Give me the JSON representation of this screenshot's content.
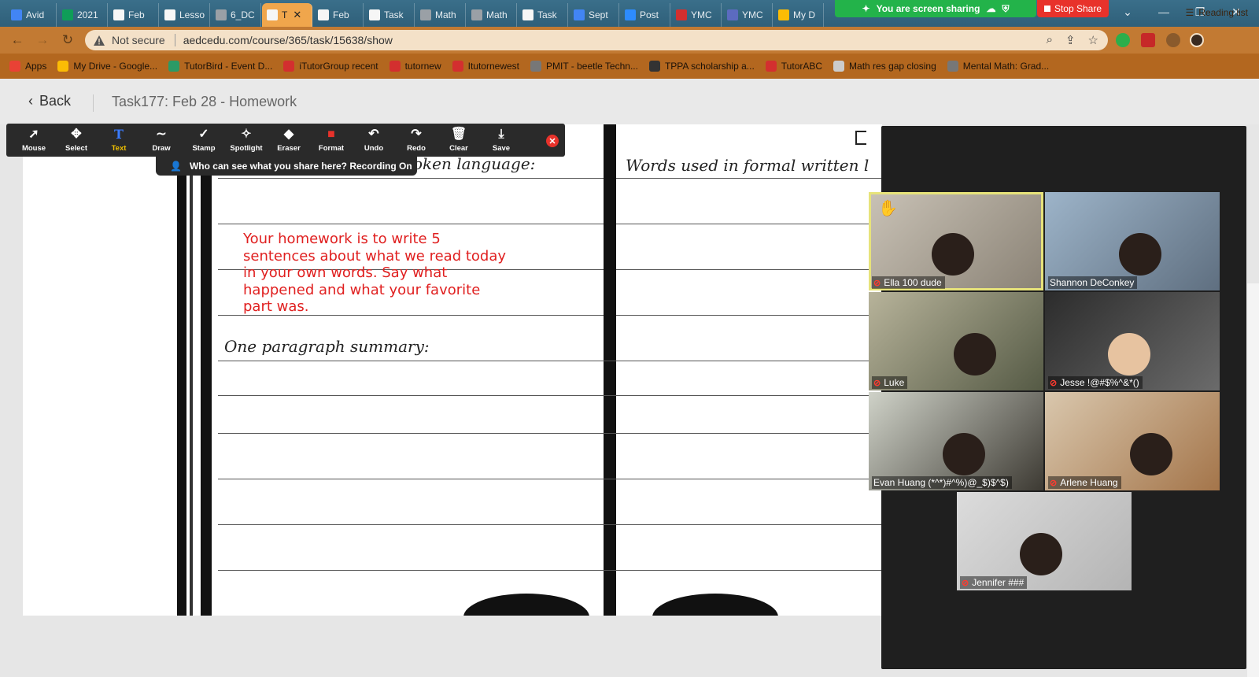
{
  "browser": {
    "tabs": [
      {
        "label": "Avid",
        "color": "#4285f4"
      },
      {
        "label": "2021",
        "color": "#0f9d58"
      },
      {
        "label": "Feb",
        "color": "#f6f6f6"
      },
      {
        "label": "Lesso",
        "color": "#f6f6f6"
      },
      {
        "label": "6_DC",
        "color": "#9aa0a6"
      },
      {
        "label": "T",
        "color": "#f6f6f6",
        "active": true
      },
      {
        "label": "Feb",
        "color": "#f6f6f6"
      },
      {
        "label": "Task",
        "color": "#f6f6f6"
      },
      {
        "label": "Math",
        "color": "#9aa0a6"
      },
      {
        "label": "Math",
        "color": "#9aa0a6"
      },
      {
        "label": "Task",
        "color": "#f6f6f6"
      },
      {
        "label": "Sept",
        "color": "#4285f4"
      },
      {
        "label": "Post",
        "color": "#2d8cff"
      },
      {
        "label": "YMC",
        "color": "#d32f2f"
      },
      {
        "label": "YMC",
        "color": "#5c6bc0"
      },
      {
        "label": "My D",
        "color": "#fbbc05"
      }
    ],
    "sharing_banner": "You are screen sharing",
    "stop_share": "Stop Share",
    "not_secure": "Not secure",
    "url": "aedcedu.com/course/365/task/15638/show",
    "bookmarks": [
      {
        "label": "Apps",
        "color": "#e94235"
      },
      {
        "label": "My Drive - Google...",
        "color": "#fbbc05"
      },
      {
        "label": "TutorBird - Event D...",
        "color": "#2b9a66"
      },
      {
        "label": "iTutorGroup recent",
        "color": "#d32f2f"
      },
      {
        "label": "tutornew",
        "color": "#d32f2f"
      },
      {
        "label": "Itutornewest",
        "color": "#d32f2f"
      },
      {
        "label": "PMIT - beetle Techn...",
        "color": "#777777"
      },
      {
        "label": "TPPA scholarship a...",
        "color": "#333333"
      },
      {
        "label": "TutorABC",
        "color": "#d32f2f"
      },
      {
        "label": "Math res gap closing",
        "color": "#cccccc"
      },
      {
        "label": "Mental Math: Grad...",
        "color": "#777777"
      }
    ],
    "reading_list": "Reading list"
  },
  "page": {
    "back_label": "Back",
    "title": "Task177:  Feb 28 - Homework"
  },
  "worksheet": {
    "left_heading_fragment": "oken language:",
    "right_heading_fragment": "Words used in formal written l",
    "summary_heading": "One paragraph summary:",
    "homework_text": "Your homework is to write 5 sentences about what we read today in your own words.  Say what happened and what your favorite part was."
  },
  "annotate": {
    "tools": [
      {
        "label": "Mouse",
        "icon": "cursor-arrow-icon",
        "glyph": "➚"
      },
      {
        "label": "Select",
        "icon": "move-arrows-icon",
        "glyph": "✥"
      },
      {
        "label": "Text",
        "icon": "text-t-icon",
        "glyph": "T",
        "selected": true
      },
      {
        "label": "Draw",
        "icon": "squiggle-icon",
        "glyph": "∼"
      },
      {
        "label": "Stamp",
        "icon": "checkmark-icon",
        "glyph": "✓"
      },
      {
        "label": "Spotlight",
        "icon": "magic-wand-icon",
        "glyph": "✧"
      },
      {
        "label": "Eraser",
        "icon": "eraser-icon",
        "glyph": "◆"
      },
      {
        "label": "Format",
        "icon": "color-square-icon",
        "glyph": "■"
      },
      {
        "label": "Undo",
        "icon": "undo-icon",
        "glyph": "↶"
      },
      {
        "label": "Redo",
        "icon": "redo-icon",
        "glyph": "↷"
      },
      {
        "label": "Clear",
        "icon": "trash-icon",
        "glyph": "🗑"
      },
      {
        "label": "Save",
        "icon": "download-icon",
        "glyph": "⤓"
      }
    ],
    "recording_note": "Who can see what you share here? Recording On",
    "accent": "#f0c000",
    "format_color": "#e8322b"
  },
  "participants": [
    {
      "name": "Ella 100 dude",
      "muted": true,
      "active_speaker": true,
      "raised_hand": true,
      "bg": "#c9c2b6",
      "bg2": "#8a8275"
    },
    {
      "name": "Shannon DeConkey",
      "muted": false,
      "active_speaker": false,
      "bg": "#9db4c9",
      "bg2": "#5f6f80"
    },
    {
      "name": "Luke",
      "muted": true,
      "active_speaker": false,
      "bg": "#b7b39a",
      "bg2": "#555a45"
    },
    {
      "name": "Jesse !@#$%^&*()",
      "muted": true,
      "active_speaker": false,
      "bg": "#2c2c2c",
      "bg2": "#6b6b6b"
    },
    {
      "name": "Evan Huang (*^*)#^%)@_$)$^$)",
      "muted": false,
      "active_speaker": false,
      "bg": "#cfd2c8",
      "bg2": "#3d3a33"
    },
    {
      "name": "Arlene Huang",
      "muted": true,
      "active_speaker": false,
      "bg": "#d9c7ad",
      "bg2": "#a4754a"
    },
    {
      "name": "Jennifer ###",
      "muted": true,
      "active_speaker": false,
      "bg": "#dcdcdc",
      "bg2": "#b4b4b4"
    }
  ]
}
